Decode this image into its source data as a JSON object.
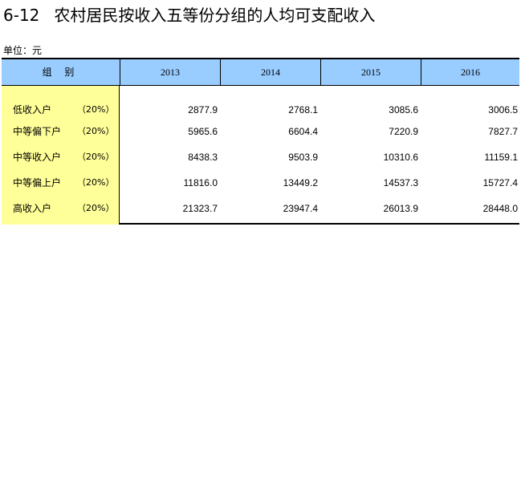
{
  "title": {
    "number": "6-12",
    "text": "农村居民按收入五等份分组的人均可支配收入"
  },
  "unit_label": "单位：元",
  "table": {
    "group_header": "组 别",
    "years": [
      "2013",
      "2014",
      "2015",
      "2016"
    ],
    "rows": [
      {
        "label": "低收入户",
        "pct": "（20%）",
        "values": [
          "2877.9",
          "2768.1",
          "3085.6",
          "3006.5"
        ]
      },
      {
        "label": "中等偏下户",
        "pct": "（20%）",
        "values": [
          "5965.6",
          "6604.4",
          "7220.9",
          "7827.7"
        ]
      },
      {
        "label": "中等收入户",
        "pct": "（20%）",
        "values": [
          "8438.3",
          "9503.9",
          "10310.6",
          "11159.1"
        ]
      },
      {
        "label": "中等偏上户",
        "pct": "（20%）",
        "values": [
          "11816.0",
          "13449.2",
          "14537.3",
          "15727.4"
        ]
      },
      {
        "label": "高收入户",
        "pct": "（20%）",
        "values": [
          "21323.7",
          "23947.4",
          "26013.9",
          "28448.0"
        ]
      }
    ]
  },
  "colors": {
    "header_bg": "#99ccff",
    "group_col_bg": "#ffff99"
  }
}
